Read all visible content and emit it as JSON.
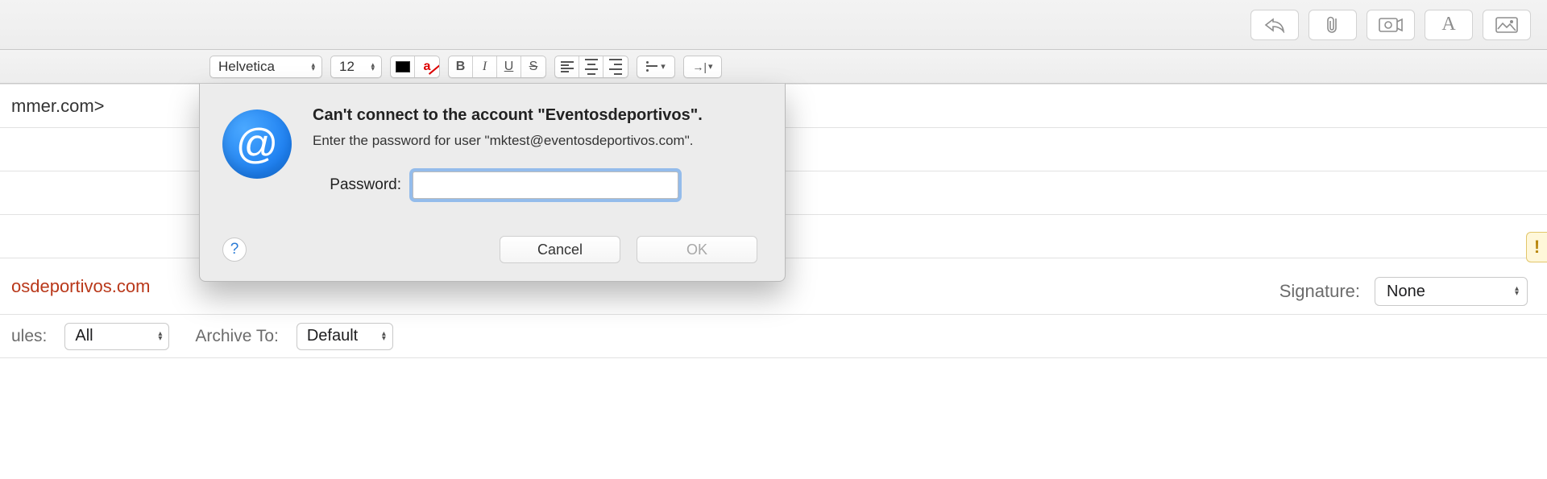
{
  "format": {
    "font": "Helvetica",
    "size": "12"
  },
  "header": {
    "to_fragment": "mmer.com>",
    "from_fragment": "osdeportivos.com",
    "rules_label": "ules:",
    "rules_value": "All",
    "archive_label": "Archive To:",
    "archive_value": "Default",
    "signature_label": "Signature:",
    "signature_value": "None"
  },
  "dialog": {
    "title": "Can't connect to the account \"Eventosdeportivos\".",
    "subtitle": "Enter the password for user \"mktest@eventosdeportivos.com\".",
    "password_label": "Password:",
    "cancel": "Cancel",
    "ok": "OK",
    "help": "?",
    "at": "@",
    "warn": "!"
  }
}
